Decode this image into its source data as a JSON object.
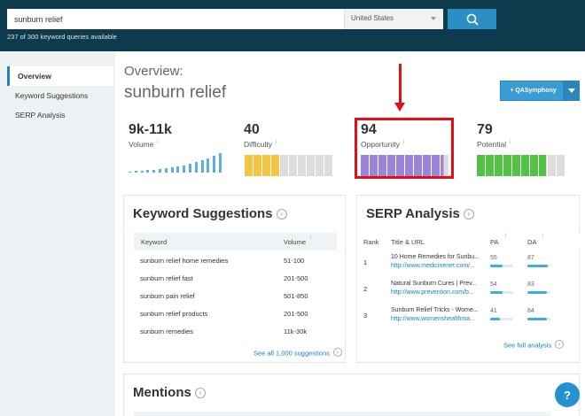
{
  "search": {
    "value": "sunburn relief",
    "country": "United States"
  },
  "queries_available": "237 of 300 keyword queries available",
  "sidebar": {
    "items": [
      {
        "label": "Overview"
      },
      {
        "label": "Keyword Suggestions"
      },
      {
        "label": "SERP Analysis"
      }
    ]
  },
  "overview": {
    "label": "Overview:",
    "title": "sunburn relief"
  },
  "qa_button": {
    "label": "+ QASymphony"
  },
  "metrics": {
    "volume": {
      "value": "9k-11k",
      "label": "Volume",
      "bars_relative": [
        0.05,
        0.07,
        0.1,
        0.12,
        0.14,
        0.16,
        0.2,
        0.24,
        0.28,
        0.33,
        0.4,
        0.48,
        0.57,
        0.68,
        0.8,
        0.92
      ]
    },
    "difficulty": {
      "value": "40",
      "label": "Difficulty",
      "score": 40
    },
    "opportunity": {
      "value": "94",
      "label": "Opportunity",
      "score": 94
    },
    "potential": {
      "value": "79",
      "label": "Potential",
      "score": 79
    }
  },
  "colors": {
    "difficulty": "#f6c445",
    "opportunity": "#9b84d9",
    "potential": "#52c245",
    "accent": "#1a84b8",
    "highlight": "#e20f14"
  },
  "keyword_suggestions": {
    "title": "Keyword Suggestions",
    "headers": {
      "keyword": "Keyword",
      "volume": "Volume"
    },
    "rows": [
      {
        "keyword": "sunburn relief home remedies",
        "volume": "51-100"
      },
      {
        "keyword": "sunburn relief fast",
        "volume": "201-500"
      },
      {
        "keyword": "sunburn pain relief",
        "volume": "501-850"
      },
      {
        "keyword": "sunburn relief products",
        "volume": "201-500"
      },
      {
        "keyword": "sunburn remedies",
        "volume": "11k-30k"
      }
    ],
    "see_all": "See all 1,000 suggestions"
  },
  "serp": {
    "title": "SERP Analysis",
    "headers": {
      "rank": "Rank",
      "title_url": "Title & URL",
      "pa": "PA",
      "da": "DA"
    },
    "rows": [
      {
        "rank": "1",
        "title": "10 Home Remedies for Sunbu...",
        "url": "http://www.medicinenet.com/...",
        "pa": "55",
        "da": "87"
      },
      {
        "rank": "2",
        "title": "Natural Sunburn Cures | Prev...",
        "url": "http://www.prevention.com/b...",
        "pa": "54",
        "da": "83"
      },
      {
        "rank": "3",
        "title": "Sunburn Relief Tricks - Wome...",
        "url": "http://www.womenshealthma...",
        "pa": "41",
        "da": "84"
      }
    ],
    "see_full": "See full analysis"
  },
  "mentions": {
    "title": "Mentions"
  },
  "chat": {
    "label": "?"
  }
}
